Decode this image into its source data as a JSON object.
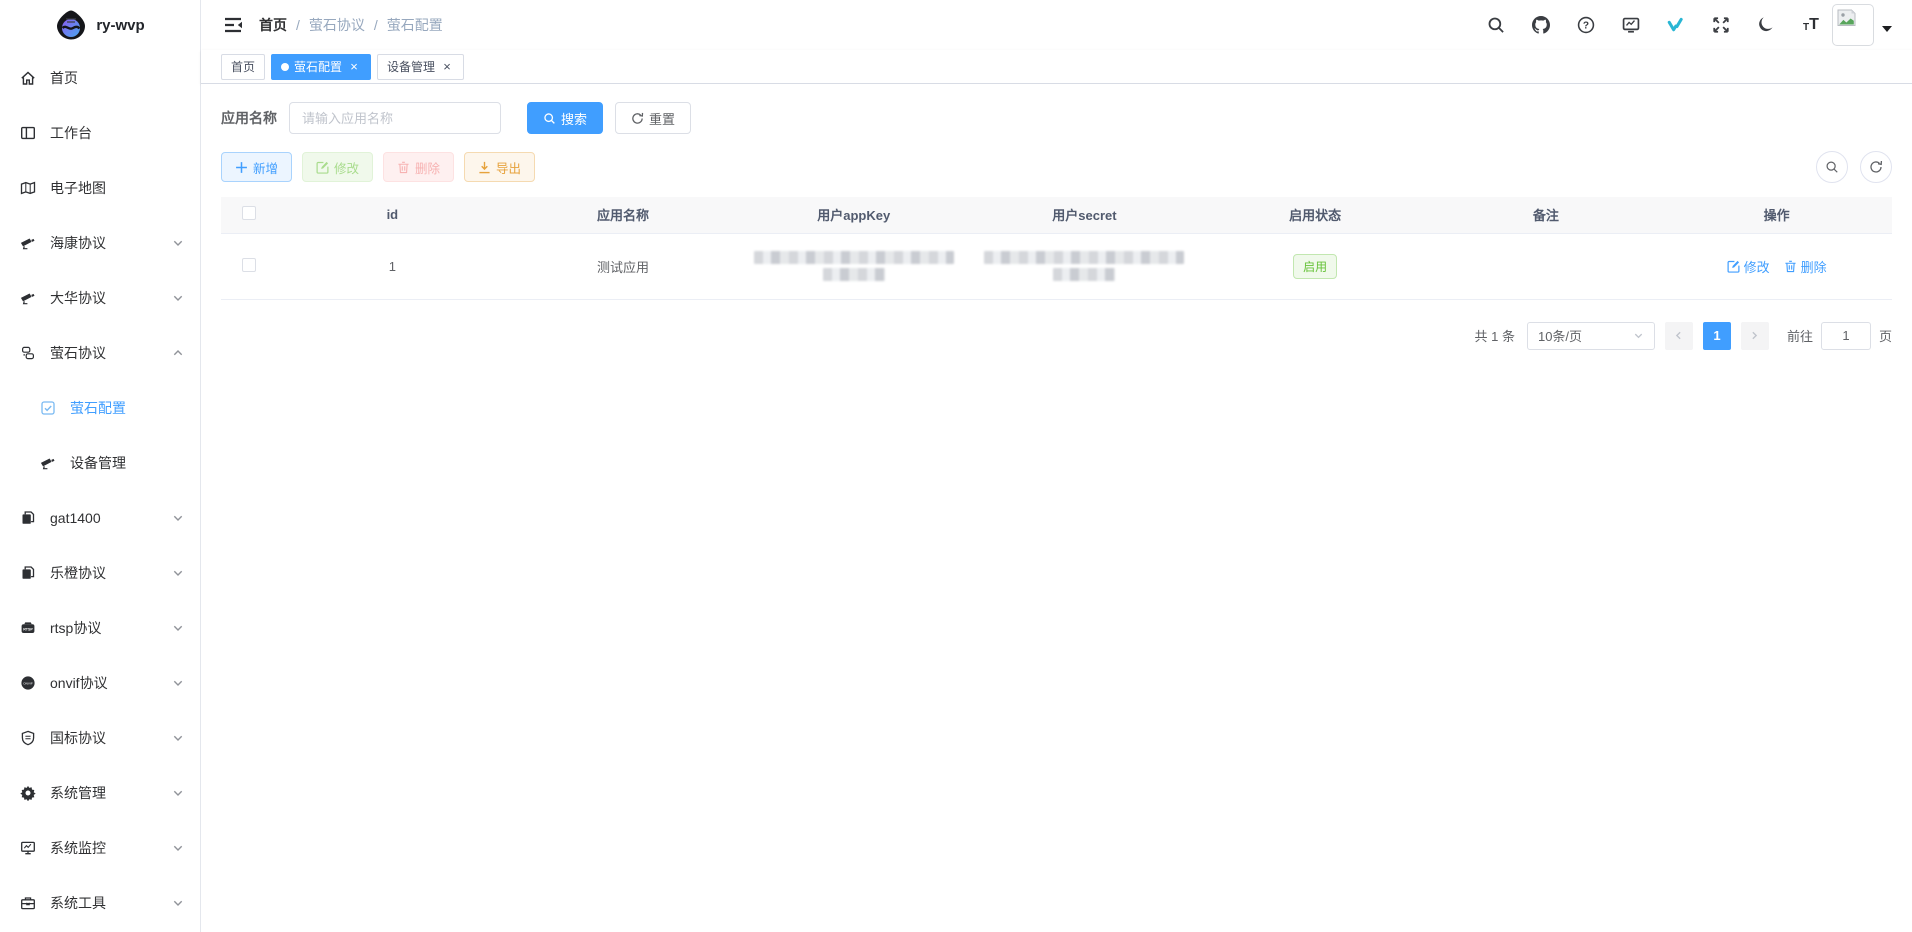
{
  "app": {
    "title": "ry-wvp"
  },
  "colors": {
    "primary": "#409EFF",
    "success": "#67C23A",
    "warning": "#E6A23C",
    "danger": "#F56C6C",
    "teal_logo": "#29B6D4"
  },
  "sidebar": {
    "logo_title": "ry-wvp",
    "items": [
      {
        "label": "首页",
        "icon": "home-icon"
      },
      {
        "label": "工作台",
        "icon": "workbench-icon"
      },
      {
        "label": "电子地图",
        "icon": "map-icon"
      },
      {
        "label": "海康协议",
        "icon": "camera-icon",
        "arrow": "down"
      },
      {
        "label": "大华协议",
        "icon": "camera-icon",
        "arrow": "down"
      },
      {
        "label": "萤石协议",
        "icon": "ezviz-icon",
        "arrow": "up"
      },
      {
        "label": "萤石配置",
        "icon": "checkbox-icon",
        "child": true,
        "active": true
      },
      {
        "label": "设备管理",
        "icon": "camera-icon",
        "child": true
      },
      {
        "label": "gat1400",
        "icon": "copy-icon",
        "arrow": "down"
      },
      {
        "label": "乐橙协议",
        "icon": "copy-icon",
        "arrow": "down"
      },
      {
        "label": "rtsp协议",
        "icon": "rtsp-icon",
        "arrow": "down"
      },
      {
        "label": "onvif协议",
        "icon": "onvif-icon",
        "arrow": "down"
      },
      {
        "label": "国标协议",
        "icon": "shield-icon",
        "arrow": "down"
      },
      {
        "label": "系统管理",
        "icon": "gear-icon",
        "arrow": "down"
      },
      {
        "label": "系统监控",
        "icon": "monitor-icon",
        "arrow": "down"
      },
      {
        "label": "系统工具",
        "icon": "toolbox-icon",
        "arrow": "down"
      }
    ]
  },
  "navbar": {
    "breadcrumb": [
      "首页",
      "萤石协议",
      "萤石配置"
    ],
    "separator": "/",
    "icons": [
      "search-icon",
      "github-icon",
      "question-icon",
      "dashboard-icon",
      "wvp-logo-icon",
      "fullscreen-icon",
      "moon-icon",
      "font-size-icon"
    ]
  },
  "tags": [
    {
      "label": "首页",
      "active": false,
      "closable": false
    },
    {
      "label": "萤石配置",
      "active": true,
      "closable": true
    },
    {
      "label": "设备管理",
      "active": false,
      "closable": true
    }
  ],
  "search": {
    "label": "应用名称",
    "placeholder": "请输入应用名称",
    "search_label": "搜索",
    "reset_label": "重置"
  },
  "toolbar": {
    "add_label": "新增",
    "edit_label": "修改",
    "delete_label": "删除",
    "export_label": "导出"
  },
  "table": {
    "columns": [
      "id",
      "应用名称",
      "用户appKey",
      "用户secret",
      "启用状态",
      "备注",
      "操作"
    ],
    "rows": [
      {
        "id": "1",
        "name": "测试应用",
        "app_key_redacted": true,
        "secret_redacted": true,
        "status": "启用",
        "remark": "",
        "actions": [
          {
            "label": "修改",
            "icon": "edit-icon"
          },
          {
            "label": "删除",
            "icon": "trash-icon"
          }
        ]
      }
    ]
  },
  "pagination": {
    "total": "共 1 条",
    "page_size": "10条/页",
    "current_page": "1",
    "goto_label": "前往",
    "goto_value": "1",
    "goto_suffix": "页"
  }
}
